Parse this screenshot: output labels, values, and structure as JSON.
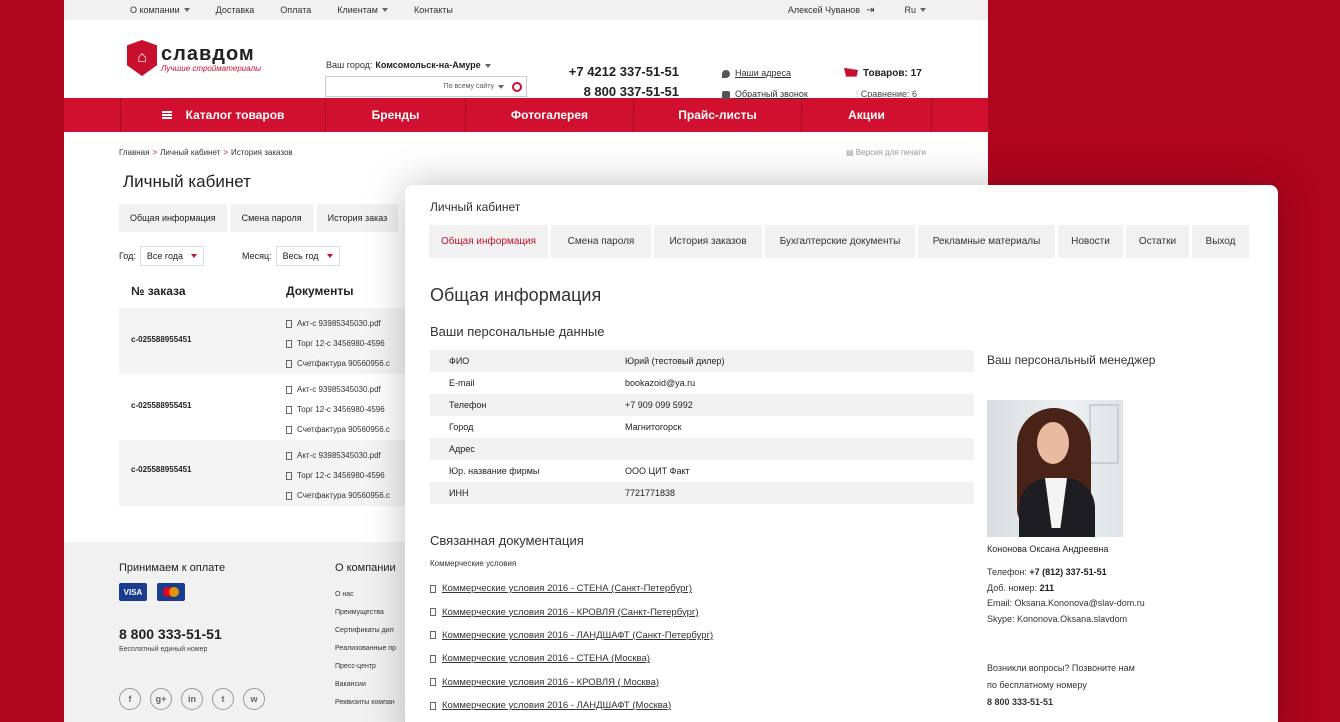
{
  "topbar": {
    "items": [
      "О компании",
      "Доставка",
      "Оплата",
      "Клиентам",
      "Контакты"
    ],
    "user": "Алексей Чуванов",
    "lang": "Ru"
  },
  "header": {
    "logo_name": "славдом",
    "logo_tagline": "Лучшие стройматериалы",
    "city_label": "Ваш город:",
    "city": "Комсомольск-на-Амуре",
    "search_placeholder": "По всему сайту",
    "phone1": "+7 4212 337-51-51",
    "phone2": "8 800 337-51-51",
    "addresses_link": "Наши адреса",
    "callback_link": "Обратный звонок",
    "cart": "Товаров: 17",
    "compare": "Сравнение: 6"
  },
  "nav": [
    "Каталог товаров",
    "Бренды",
    "Фотогалерея",
    "Прайс-листы",
    "Акции"
  ],
  "breadcrumbs": [
    "Главная",
    "Личный кабинет",
    "История заказов"
  ],
  "print_label": "Версия для печати",
  "bg": {
    "title": "Личный кабинет",
    "tabs": [
      "Общая информация",
      "Смена пароля",
      "История заказ"
    ],
    "year_label": "Год:",
    "year_value": "Все года",
    "month_label": "Месяц:",
    "month_value": "Весь год",
    "col_order": "№ заказа",
    "col_docs": "Документы",
    "orders": [
      {
        "num": "с-025588955451",
        "docs": [
          "Акт-с 93985345030.pdf",
          "Торг 12-с 3456980-4596",
          "Счетфактура 90560956.c"
        ]
      },
      {
        "num": "с-025588955451",
        "docs": [
          "Акт-с 93985345030.pdf",
          "Торг 12-с 3456980-4596",
          "Счетфактура 90560956.c"
        ]
      },
      {
        "num": "с-025588955451",
        "docs": [
          "Акт-с 93985345030.pdf",
          "Торг 12-с 3456980-4596",
          "Счетфактура 90560956.c"
        ]
      }
    ]
  },
  "footer": {
    "pay_title": "Принимаем к оплате",
    "visa": "VISA",
    "phone": "8 800 333-51-51",
    "phone_sub": "Бесплатный единый номер",
    "col_title": "О компании",
    "col_items": [
      "О нас",
      "Преимущества",
      "Сертификаты дил",
      "Реализованные пр",
      "Пресс-центр",
      "Вакансии",
      "Реквизиты компан"
    ],
    "socials": [
      "f",
      "g+",
      "in",
      "t",
      "w"
    ]
  },
  "fg": {
    "head": "Личный кабинет",
    "tabs": [
      "Общая информация",
      "Смена пароля",
      "История заказов",
      "Бухгалтерские документы",
      "Рекламные материалы",
      "Новости",
      "Остатки",
      "Выход"
    ],
    "title": "Общая информация",
    "subtitle": "Ваши персональные данные",
    "personal": [
      {
        "k": "ФИО",
        "v": "Юрий (тестовый дилер)"
      },
      {
        "k": "E-mail",
        "v": "bookazoid@ya.ru"
      },
      {
        "k": "Телефон",
        "v": "+7 909 099 5992"
      },
      {
        "k": "Город",
        "v": "Магнитогорск"
      },
      {
        "k": "Адрес",
        "v": ""
      },
      {
        "k": "Юр. название фирмы",
        "v": "ООО ЦИТ Факт"
      },
      {
        "k": "ИНН",
        "v": "7721771838"
      }
    ],
    "manager_title": "Ваш персональный менеджер",
    "manager_name": "Кононова Оксана Андреевна",
    "manager_phone_label": "Телефон:",
    "manager_phone": "+7 (812) 337-51-51",
    "manager_ext_label": "Доб. номер:",
    "manager_ext": "211",
    "manager_email_label": "Email:",
    "manager_email": "Oksana.Kononova@slav-dom.ru",
    "manager_skype_label": "Skype:",
    "manager_skype": "Kononova.Oksana.slavdom",
    "question_line1": "Возникли вопросы? Позвоните нам",
    "question_line2": "по бесплатному номеру",
    "question_phone": "8 800 333-51-51",
    "related_title": "Связанная документация",
    "related_sub": "Коммерческие условия",
    "related": [
      "Коммерческие условия 2016 - СТЕНА (Санкт-Петербург)",
      "Коммерческие условия 2016 - КРОВЛЯ (Санкт-Петербург)",
      "Коммерческие условия 2016 - ЛАНДШАФТ (Санкт-Петербург)",
      "Коммерческие условия 2016 - СТЕНА (Москва)",
      "Коммерческие условия 2016 - КРОВЛЯ ( Москва)",
      "Коммерческие условия 2016 - ЛАНДШАФТ (Москва)"
    ]
  },
  "colors": {
    "brand": "#d0102e",
    "background": "#b0051e"
  }
}
